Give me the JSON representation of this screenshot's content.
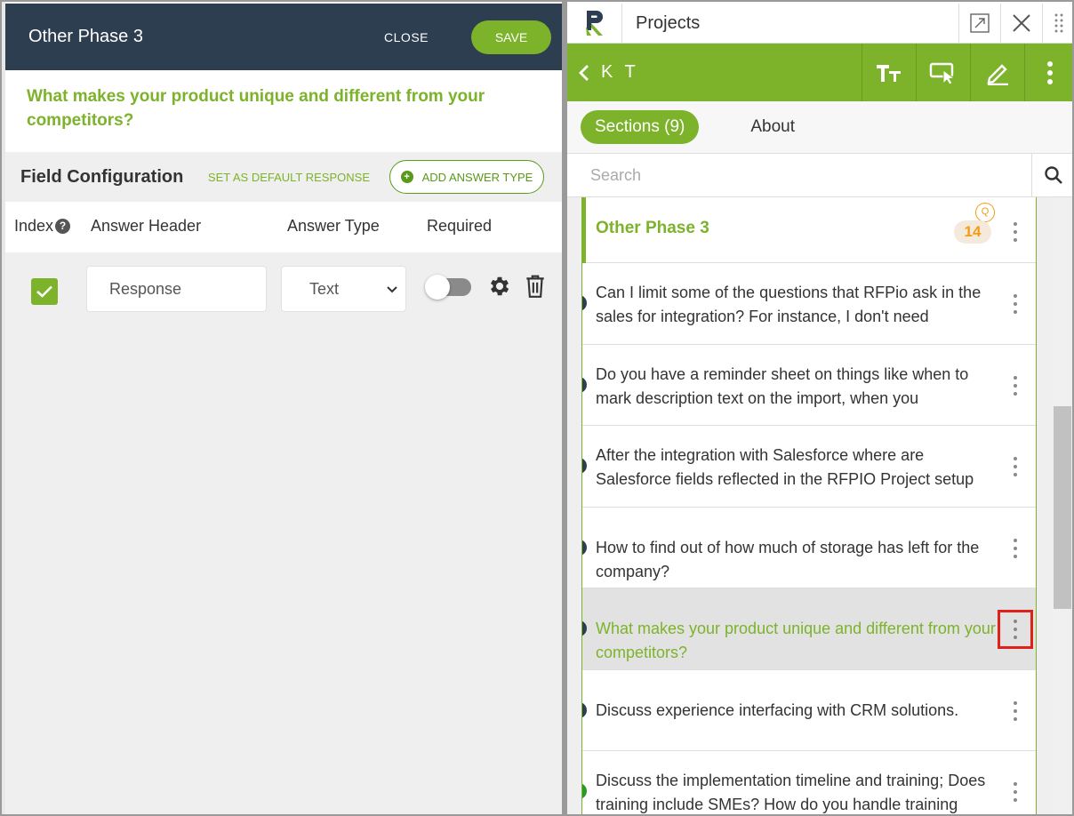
{
  "left_panel": {
    "title": "Other Phase 3",
    "close_label": "CLOSE",
    "save_label": "SAVE",
    "question": "What makes your product unique and different from your competitors?",
    "field_config": {
      "title": "Field Configuration",
      "set_default_label": "SET AS DEFAULT RESPONSE",
      "add_answer_type_label": "ADD ANSWER TYPE"
    },
    "columns": {
      "index": "Index",
      "answer_header": "Answer Header",
      "answer_type": "Answer Type",
      "required": "Required"
    },
    "row": {
      "checked": true,
      "answer_header_value": "Response",
      "answer_type_value": "Text",
      "required_on": false
    }
  },
  "right_panel": {
    "app_title": "Projects",
    "project_name": "K T",
    "tabs": {
      "sections": "Sections (9)",
      "about": "About"
    },
    "search_placeholder": "Search",
    "section": {
      "title": "Other Phase 3",
      "q_badge": "Q",
      "count": "14"
    },
    "questions": [
      {
        "text": "Can I limit some of the questions that RFPio ask in the sales for integration? For instance, I don't need",
        "dot_color": "#2c3e50",
        "active": false
      },
      {
        "text": "Do you have a reminder sheet on things like when to mark description text on the import, when you",
        "dot_color": "#2c3e50",
        "active": false
      },
      {
        "text": "After the integration with Salesforce where are Salesforce fields reflected in the RFPIO Project setup",
        "dot_color": "#2c3e50",
        "active": false
      },
      {
        "text": "How to find out of how much of storage has left for the company?",
        "dot_color": "#2c3e50",
        "active": false
      },
      {
        "text": "What makes your product unique and different from your competitors?",
        "dot_color": "#2c3e50",
        "active": true
      },
      {
        "text": "Discuss experience interfacing with CRM solutions.",
        "dot_color": "#2c3e50",
        "active": false
      },
      {
        "text": "Discuss the implementation timeline and training; Does training include SMEs? How do you handle training",
        "dot_color": "#2a9a2a",
        "active": false
      }
    ]
  },
  "colors": {
    "brand_green": "#7cb32b",
    "header_navy": "#2c3e50",
    "badge_orange": "#f39c12",
    "highlight_red": "#e0201a"
  }
}
